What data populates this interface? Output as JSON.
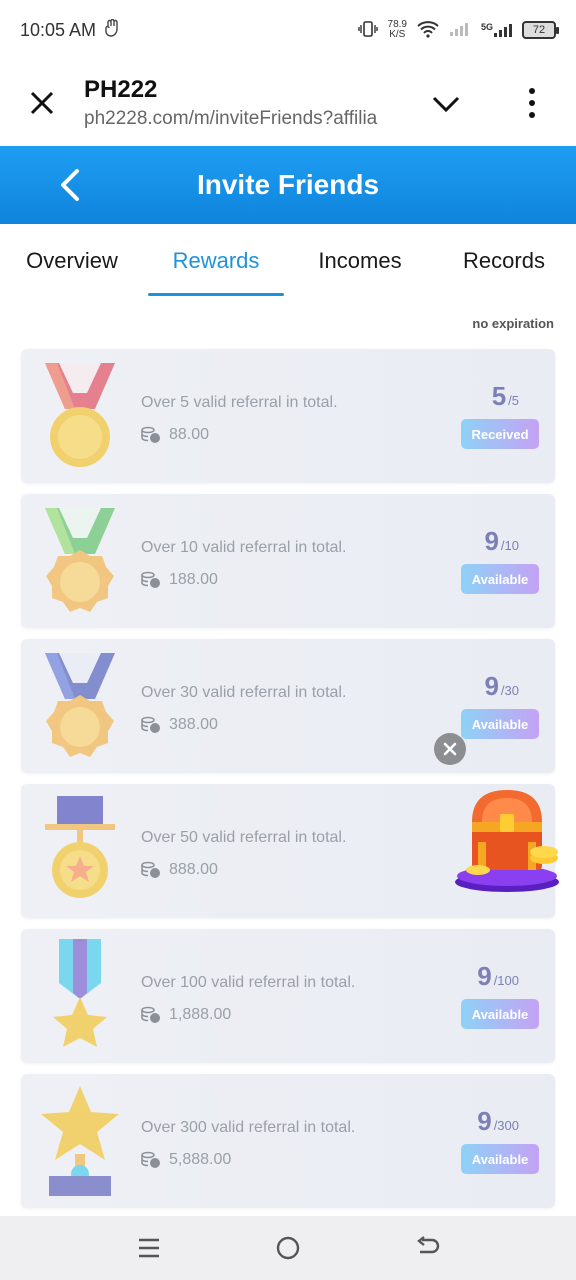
{
  "status_bar": {
    "time": "10:05 AM",
    "net_speed_value": "78.9",
    "net_speed_unit": "K/S",
    "network": "5G",
    "battery": "72"
  },
  "browser": {
    "title": "PH222",
    "url": "ph2228.com/m/inviteFriends?affilia"
  },
  "header": {
    "title": "Invite Friends"
  },
  "tabs": [
    {
      "label": "Overview",
      "active": false
    },
    {
      "label": "Rewards",
      "active": true
    },
    {
      "label": "Incomes",
      "active": false
    },
    {
      "label": "Records",
      "active": false
    }
  ],
  "rewards": {
    "expiration_note": "no expiration",
    "items": [
      {
        "description": "Over 5 valid referral in total.",
        "amount": "88.00",
        "progress": "5",
        "target": "/5",
        "status": "Received",
        "medal": "red-ribbon-medal"
      },
      {
        "description": "Over 10 valid referral in total.",
        "amount": "188.00",
        "progress": "9",
        "target": "/10",
        "status": "Available",
        "medal": "green-ribbon-medal"
      },
      {
        "description": "Over 30 valid referral in total.",
        "amount": "388.00",
        "progress": "9",
        "target": "/30",
        "status": "Available",
        "medal": "blue-ribbon-medal"
      },
      {
        "description": "Over 50 valid referral in total.",
        "amount": "888.00",
        "progress": "",
        "target": "",
        "status": "",
        "medal": "star-medal"
      },
      {
        "description": "Over 100 valid referral in total.",
        "amount": "1,888.00",
        "progress": "9",
        "target": "/100",
        "status": "Available",
        "medal": "star-ribbon-medal"
      },
      {
        "description": "Over 300 valid referral in total.",
        "amount": "5,888.00",
        "progress": "9",
        "target": "/300",
        "status": "Available",
        "medal": "star-trophy"
      }
    ]
  },
  "colors": {
    "header_blue": "#1e9ef2",
    "tab_active": "#1e92dd",
    "progress_text": "#7c80b6"
  }
}
